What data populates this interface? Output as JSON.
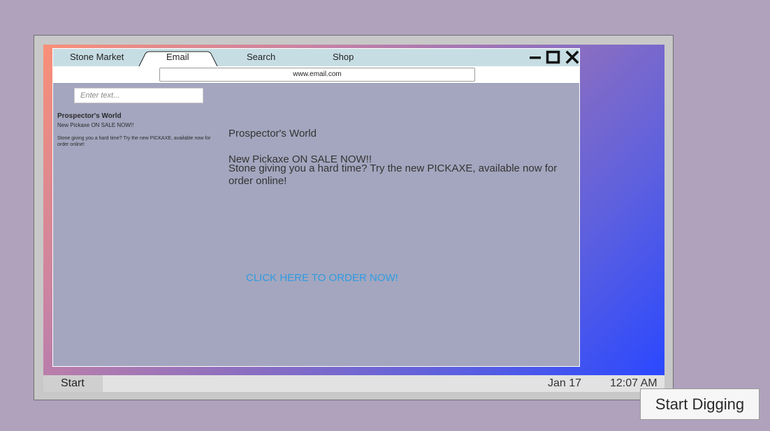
{
  "browser": {
    "tabs": [
      {
        "label": "Stone Market"
      },
      {
        "label": "Email",
        "active": true
      },
      {
        "label": "Search"
      },
      {
        "label": "Shop"
      }
    ],
    "address_bar": {
      "url": "www.email.com"
    },
    "window_controls": [
      "minimize-icon",
      "maximize-icon",
      "close-icon"
    ]
  },
  "inbox": {
    "search_placeholder": "Enter text...",
    "emails": [
      {
        "sender": "Prospector's World",
        "subject": "New Pickaxe ON SALE NOW!!",
        "preview": "Stone giving you a hard time? Try the new PICKAXE, available now for order online!"
      }
    ]
  },
  "message": {
    "sender": "Prospector's World",
    "subject": "New Pickaxe ON SALE NOW!!",
    "body": "Stone giving you a hard time? Try the new PICKAXE, available now for order online!",
    "link_label": "CLICK HERE TO ORDER NOW!"
  },
  "taskbar": {
    "start_label": "Start",
    "date": "Jan 17",
    "time": "12:07 AM"
  },
  "actions": {
    "start_digging_label": "Start Digging"
  },
  "colors": {
    "background": "#b0a2bd",
    "browser_content": "#a4a6bf",
    "tab_bar": "#c7dde4",
    "link": "#2f9be0"
  }
}
